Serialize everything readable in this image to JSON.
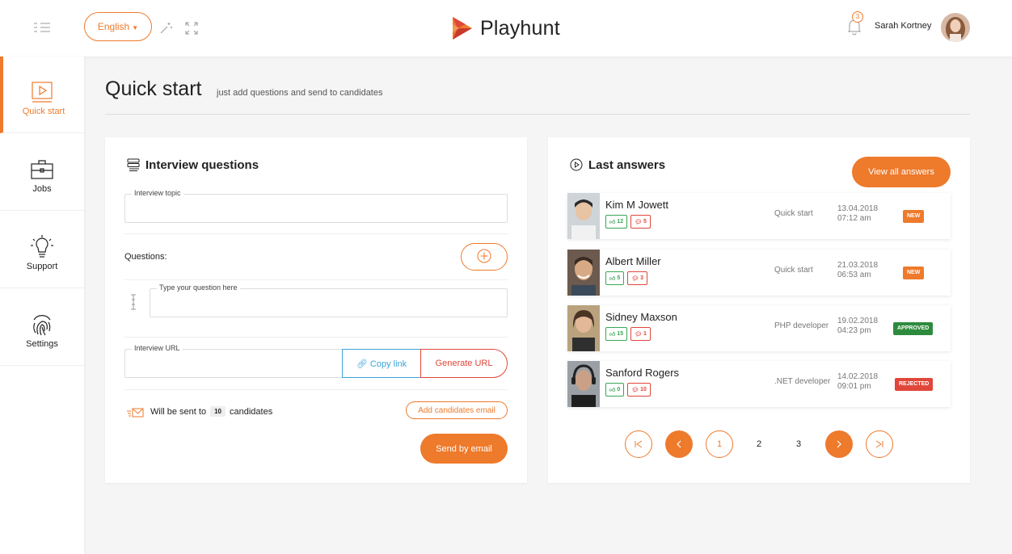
{
  "header": {
    "language": "English",
    "brand": "Playhunt",
    "notifications_count": "3",
    "user_name": "Sarah Kortney"
  },
  "sidebar": {
    "items": [
      {
        "label": "Quick start",
        "icon": "play-icon"
      },
      {
        "label": "Jobs",
        "icon": "briefcase-icon"
      },
      {
        "label": "Support",
        "icon": "lightbulb-icon"
      },
      {
        "label": "Settings",
        "icon": "fingerprint-icon"
      }
    ]
  },
  "page": {
    "title": "Quick start",
    "subtitle": "just add questions and send to candidates"
  },
  "interview": {
    "title": "Interview questions",
    "topic_legend": "Interview topic",
    "topic_value": "",
    "questions_label": "Questions:",
    "question_legend": "Type your question here",
    "question_value": "",
    "url_legend": "Interview URL",
    "url_value": "",
    "copy_link_label": "Copy link",
    "generate_url_label": "Generate URL",
    "sent_prefix": "Will be sent to",
    "sent_count": "10",
    "sent_suffix": "candidates",
    "add_email_label": "Add candidates email",
    "send_label": "Send by email"
  },
  "answers": {
    "title": "Last answers",
    "view_all_label": "View all answers",
    "rows": [
      {
        "name": "Kim M Jowett",
        "likes": "12",
        "comments": "5",
        "job": "Quick start",
        "date": "13.04.2018",
        "time": "07:12 am",
        "status": "NEW"
      },
      {
        "name": "Albert Miller",
        "likes": "5",
        "comments": "3",
        "job": "Quick start",
        "date": "21.03.2018",
        "time": "06:53 am",
        "status": "NEW"
      },
      {
        "name": "Sidney Maxson",
        "likes": "15",
        "comments": "1",
        "job": "PHP developer",
        "date": "19.02.2018",
        "time": "04:23 pm",
        "status": "APPROVED"
      },
      {
        "name": "Sanford Rogers",
        "likes": "0",
        "comments": "10",
        "job": ".NET developer",
        "date": "14.02.2018",
        "time": "09:01 pm",
        "status": "REJECTED"
      }
    ],
    "pagination": {
      "pages": [
        "1",
        "2",
        "3"
      ],
      "current": "1"
    }
  },
  "colors": {
    "accent": "#ee7a2c",
    "link_blue": "#3ca3d9",
    "danger": "#e0473a",
    "success": "#3aa655",
    "approved": "#2e8b3e"
  }
}
